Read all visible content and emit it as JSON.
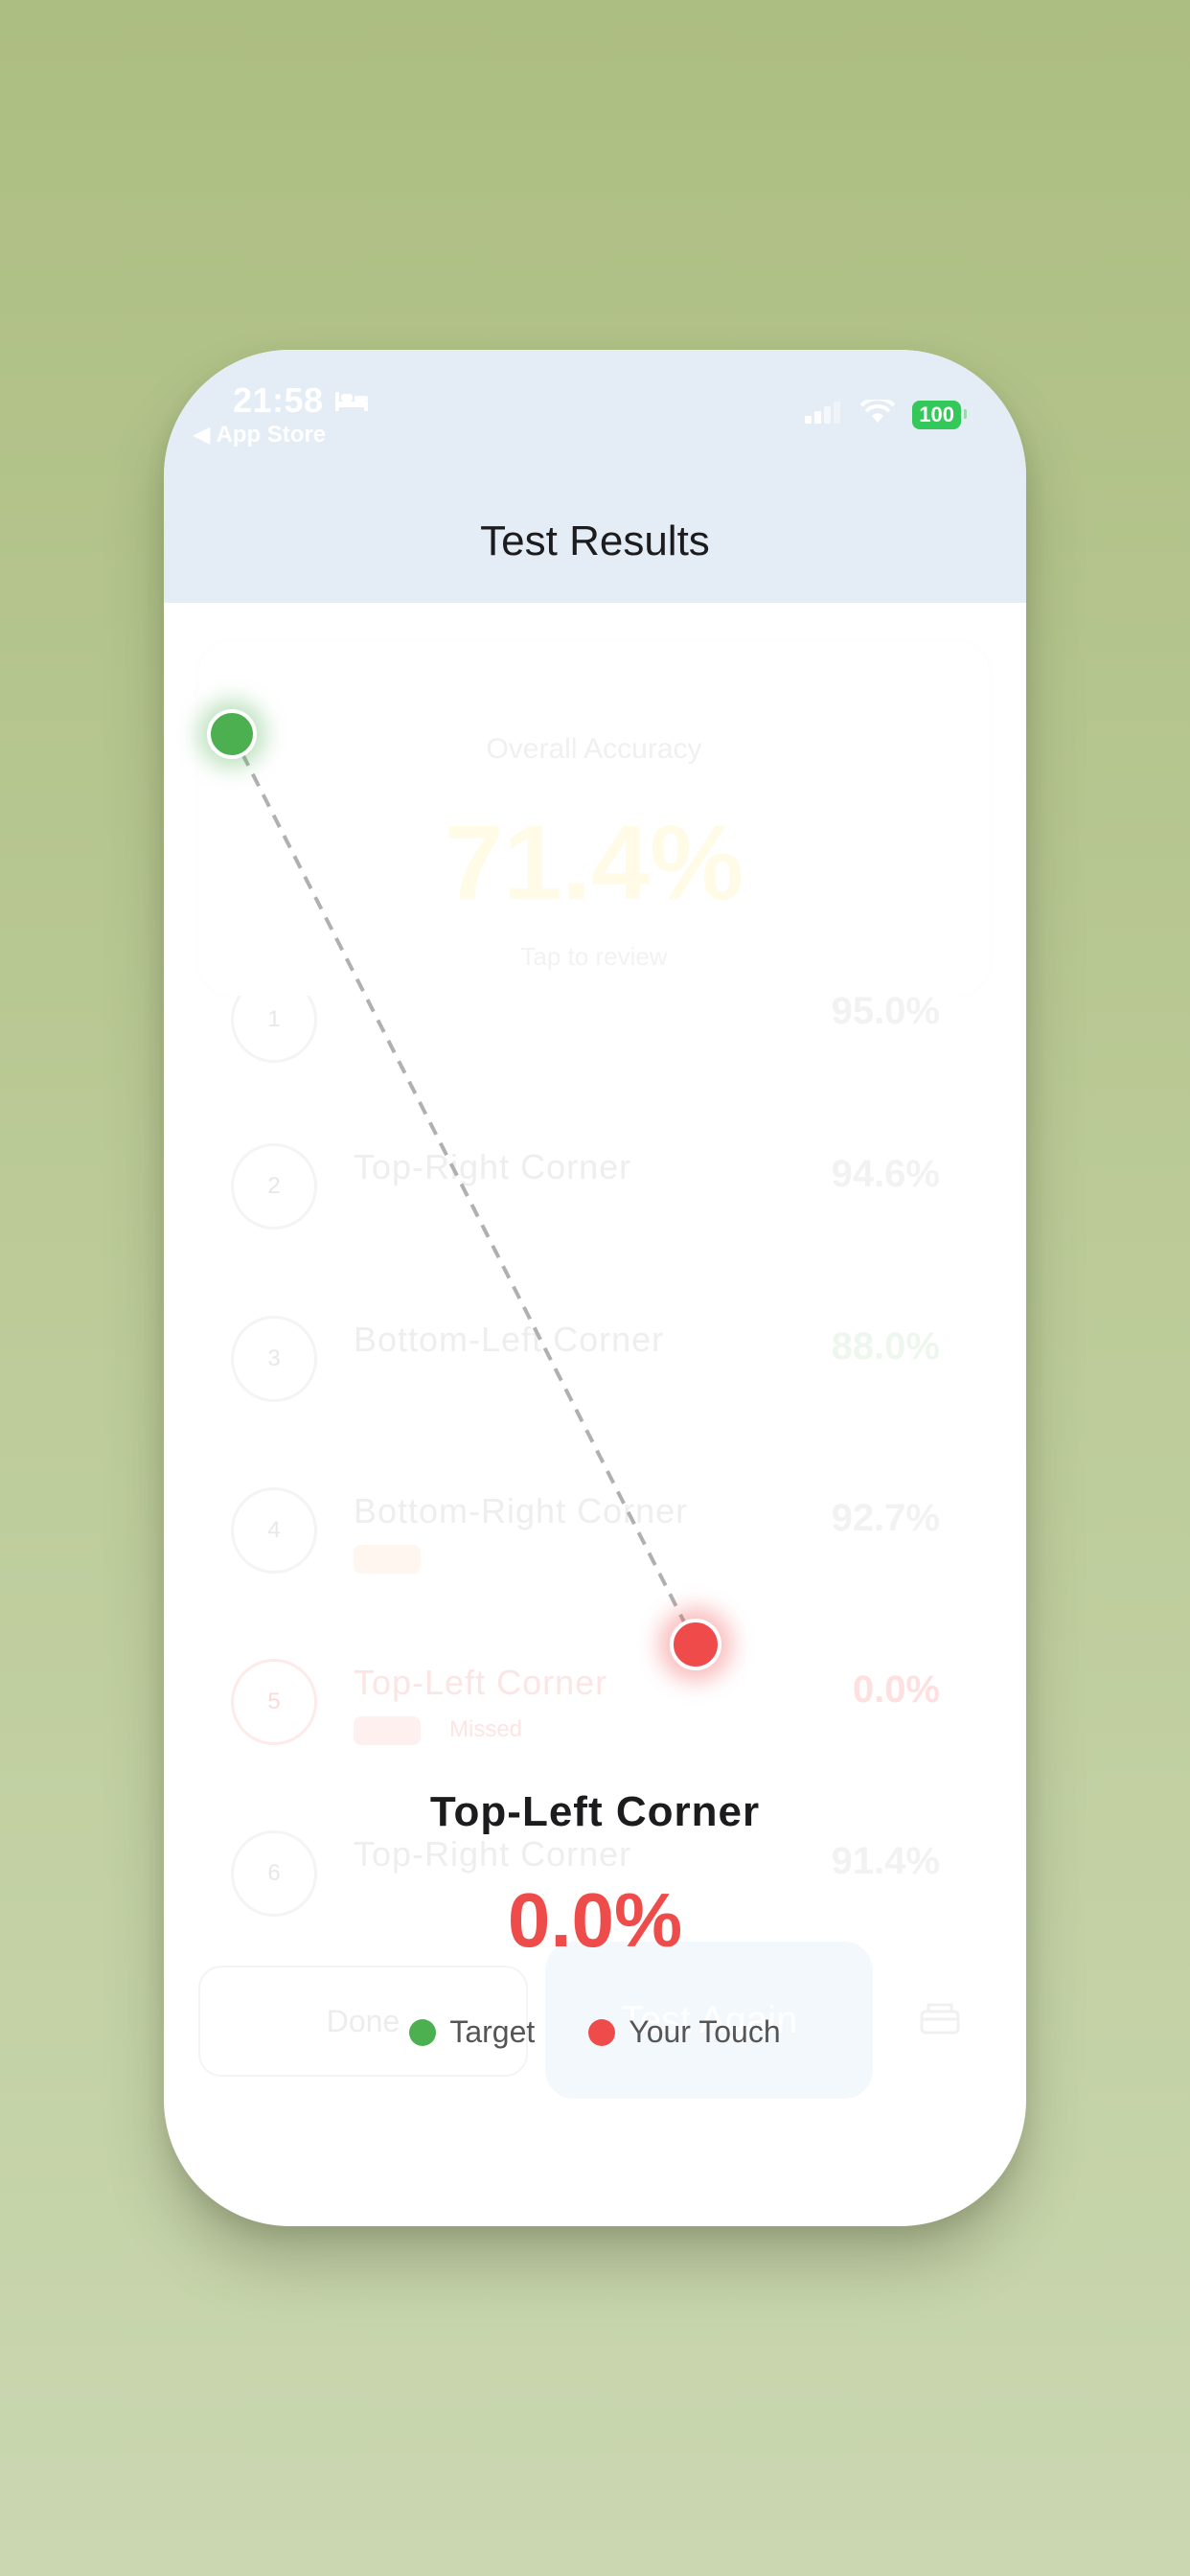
{
  "status": {
    "time": "21:58",
    "back_label": "App Store",
    "battery": "100"
  },
  "header": {
    "title": "Test Results"
  },
  "summary": {
    "label": "Overall Accuracy",
    "value": "71.4%",
    "hint": "Tap to review"
  },
  "rows": [
    {
      "num": "1",
      "name": "",
      "pct": "95.0%"
    },
    {
      "num": "2",
      "name": "Top-Right Corner",
      "pct": "94.6%"
    },
    {
      "num": "3",
      "name": "Bottom-Left Corner",
      "pct": "88.0%"
    },
    {
      "num": "4",
      "name": "Bottom-Right Corner",
      "pct": "92.7%"
    },
    {
      "num": "5",
      "name": "Top-Left Corner",
      "pct": "0.0%",
      "tag": "Missed"
    },
    {
      "num": "6",
      "name": "Top-Right Corner",
      "pct": "91.4%"
    }
  ],
  "buttons": {
    "done": "Done",
    "test_again": "Test Again"
  },
  "result": {
    "name": "Top-Left Corner",
    "pct": "0.0%"
  },
  "legend": {
    "target": "Target",
    "touch": "Your Touch"
  },
  "colors": {
    "target": "#4caf50",
    "touch": "#f04b4b",
    "header_bg": "#e4ecf5"
  },
  "icons": [
    "bed-icon",
    "signal-icon",
    "wifi-icon",
    "battery-icon",
    "share-icon"
  ]
}
